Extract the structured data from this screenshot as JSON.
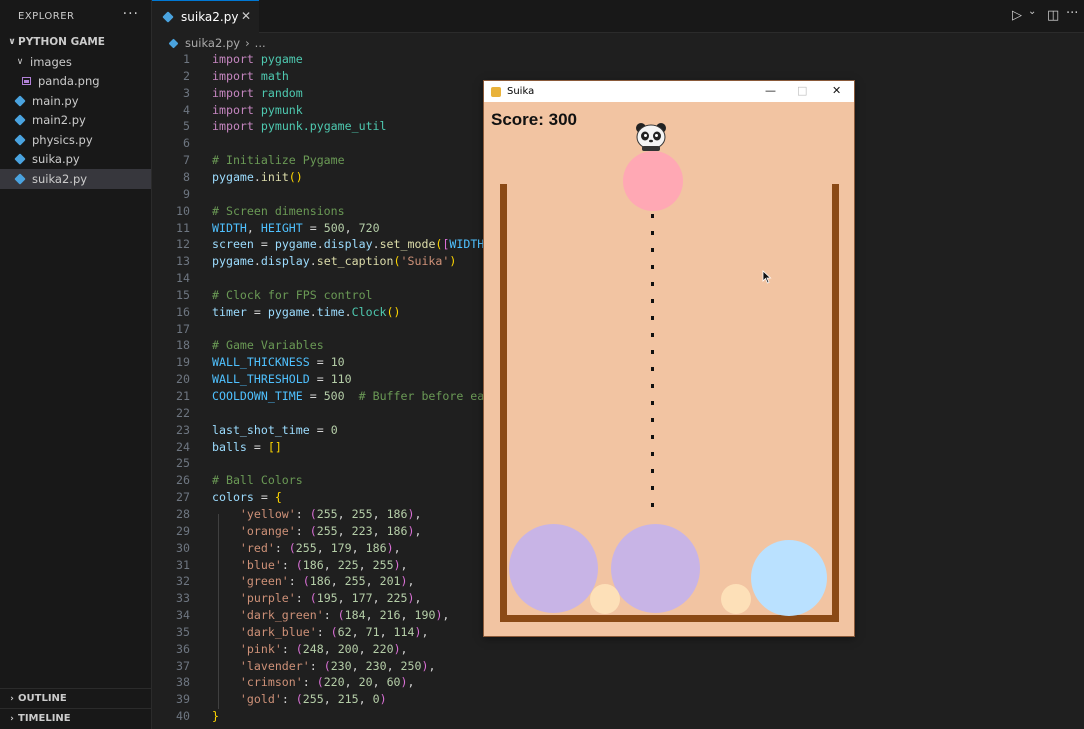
{
  "sidebar": {
    "title": "EXPLORER",
    "more": "···",
    "folder": "PYTHON GAME",
    "subfolder": "images",
    "items": [
      {
        "label": "panda.png"
      },
      {
        "label": "main.py"
      },
      {
        "label": "main2.py"
      },
      {
        "label": "physics.py"
      },
      {
        "label": "suika.py"
      },
      {
        "label": "suika2.py"
      }
    ],
    "outline": "OUTLINE",
    "timeline": "TIMELINE"
  },
  "tab": {
    "label": "suika2.py",
    "close": "✕"
  },
  "breadcrumb": {
    "file": "suika2.py",
    "rest": "..."
  },
  "toolbar": {
    "run": "▷",
    "run_menu": "⌄",
    "split": "◫",
    "more": "···"
  },
  "editor": {
    "line_numbers": [
      "1",
      "2",
      "3",
      "4",
      "5",
      "6",
      "7",
      "8",
      "9",
      "10",
      "11",
      "12",
      "13",
      "14",
      "15",
      "16",
      "17",
      "18",
      "19",
      "20",
      "21",
      "22",
      "23",
      "24",
      "25",
      "26",
      "27",
      "28",
      "29",
      "30",
      "31",
      "32",
      "33",
      "34",
      "35",
      "36",
      "37",
      "38",
      "39",
      "40"
    ],
    "lines": [
      [
        {
          "t": "import ",
          "c": "kw"
        },
        {
          "t": "pygame",
          "c": "mod"
        }
      ],
      [
        {
          "t": "import ",
          "c": "kw"
        },
        {
          "t": "math",
          "c": "mod"
        }
      ],
      [
        {
          "t": "import ",
          "c": "kw"
        },
        {
          "t": "random",
          "c": "mod"
        }
      ],
      [
        {
          "t": "import ",
          "c": "kw"
        },
        {
          "t": "pymunk",
          "c": "mod"
        }
      ],
      [
        {
          "t": "import ",
          "c": "kw"
        },
        {
          "t": "pymunk.pygame_util",
          "c": "mod"
        }
      ],
      [],
      [
        {
          "t": "# Initialize Pygame",
          "c": "cm"
        }
      ],
      [
        {
          "t": "pygame",
          "c": "var"
        },
        {
          "t": ".",
          "c": "op"
        },
        {
          "t": "init",
          "c": "fn"
        },
        {
          "t": "()",
          "c": "br"
        }
      ],
      [],
      [
        {
          "t": "# Screen dimensions",
          "c": "cm"
        }
      ],
      [
        {
          "t": "WIDTH",
          "c": "const"
        },
        {
          "t": ", ",
          "c": "op"
        },
        {
          "t": "HEIGHT",
          "c": "const"
        },
        {
          "t": " = ",
          "c": "op"
        },
        {
          "t": "500",
          "c": "num"
        },
        {
          "t": ", ",
          "c": "op"
        },
        {
          "t": "720",
          "c": "num"
        }
      ],
      [
        {
          "t": "screen",
          "c": "var"
        },
        {
          "t": " = ",
          "c": "op"
        },
        {
          "t": "pygame",
          "c": "var"
        },
        {
          "t": ".",
          "c": "op"
        },
        {
          "t": "display",
          "c": "var"
        },
        {
          "t": ".",
          "c": "op"
        },
        {
          "t": "set_mode",
          "c": "fn"
        },
        {
          "t": "(",
          "c": "br"
        },
        {
          "t": "[",
          "c": "br2"
        },
        {
          "t": "WIDTH",
          "c": "const"
        }
      ],
      [
        {
          "t": "pygame",
          "c": "var"
        },
        {
          "t": ".",
          "c": "op"
        },
        {
          "t": "display",
          "c": "var"
        },
        {
          "t": ".",
          "c": "op"
        },
        {
          "t": "set_caption",
          "c": "fn"
        },
        {
          "t": "(",
          "c": "br"
        },
        {
          "t": "'Suika'",
          "c": "str"
        },
        {
          "t": ")",
          "c": "br"
        }
      ],
      [],
      [
        {
          "t": "# Clock for FPS control",
          "c": "cm"
        }
      ],
      [
        {
          "t": "timer",
          "c": "var"
        },
        {
          "t": " = ",
          "c": "op"
        },
        {
          "t": "pygame",
          "c": "var"
        },
        {
          "t": ".",
          "c": "op"
        },
        {
          "t": "time",
          "c": "var"
        },
        {
          "t": ".",
          "c": "op"
        },
        {
          "t": "Clock",
          "c": "mod"
        },
        {
          "t": "()",
          "c": "br"
        }
      ],
      [],
      [
        {
          "t": "# Game Variables",
          "c": "cm"
        }
      ],
      [
        {
          "t": "WALL_THICKNESS",
          "c": "const"
        },
        {
          "t": " = ",
          "c": "op"
        },
        {
          "t": "10",
          "c": "num"
        }
      ],
      [
        {
          "t": "WALL_THRESHOLD",
          "c": "const"
        },
        {
          "t": " = ",
          "c": "op"
        },
        {
          "t": "110",
          "c": "num"
        }
      ],
      [
        {
          "t": "COOLDOWN_TIME",
          "c": "const"
        },
        {
          "t": " = ",
          "c": "op"
        },
        {
          "t": "500",
          "c": "num"
        },
        {
          "t": "  ",
          "c": "op"
        },
        {
          "t": "# Buffer before ea",
          "c": "cm"
        }
      ],
      [],
      [
        {
          "t": "last_shot_time",
          "c": "var"
        },
        {
          "t": " = ",
          "c": "op"
        },
        {
          "t": "0",
          "c": "num"
        }
      ],
      [
        {
          "t": "balls",
          "c": "var"
        },
        {
          "t": " = ",
          "c": "op"
        },
        {
          "t": "[]",
          "c": "br"
        }
      ],
      [],
      [
        {
          "t": "# Ball Colors",
          "c": "cm"
        }
      ],
      [
        {
          "t": "colors",
          "c": "var"
        },
        {
          "t": " = ",
          "c": "op"
        },
        {
          "t": "{",
          "c": "br"
        }
      ],
      [
        {
          "t": "    ",
          "c": "op"
        },
        {
          "t": "'yellow'",
          "c": "str"
        },
        {
          "t": ": ",
          "c": "op"
        },
        {
          "t": "(",
          "c": "br2"
        },
        {
          "t": "255",
          "c": "num"
        },
        {
          "t": ", ",
          "c": "op"
        },
        {
          "t": "255",
          "c": "num"
        },
        {
          "t": ", ",
          "c": "op"
        },
        {
          "t": "186",
          "c": "num"
        },
        {
          "t": ")",
          "c": "br2"
        },
        {
          "t": ",",
          "c": "op"
        }
      ],
      [
        {
          "t": "    ",
          "c": "op"
        },
        {
          "t": "'orange'",
          "c": "str"
        },
        {
          "t": ": ",
          "c": "op"
        },
        {
          "t": "(",
          "c": "br2"
        },
        {
          "t": "255",
          "c": "num"
        },
        {
          "t": ", ",
          "c": "op"
        },
        {
          "t": "223",
          "c": "num"
        },
        {
          "t": ", ",
          "c": "op"
        },
        {
          "t": "186",
          "c": "num"
        },
        {
          "t": ")",
          "c": "br2"
        },
        {
          "t": ",",
          "c": "op"
        }
      ],
      [
        {
          "t": "    ",
          "c": "op"
        },
        {
          "t": "'red'",
          "c": "str"
        },
        {
          "t": ": ",
          "c": "op"
        },
        {
          "t": "(",
          "c": "br2"
        },
        {
          "t": "255",
          "c": "num"
        },
        {
          "t": ", ",
          "c": "op"
        },
        {
          "t": "179",
          "c": "num"
        },
        {
          "t": ", ",
          "c": "op"
        },
        {
          "t": "186",
          "c": "num"
        },
        {
          "t": ")",
          "c": "br2"
        },
        {
          "t": ",",
          "c": "op"
        }
      ],
      [
        {
          "t": "    ",
          "c": "op"
        },
        {
          "t": "'blue'",
          "c": "str"
        },
        {
          "t": ": ",
          "c": "op"
        },
        {
          "t": "(",
          "c": "br2"
        },
        {
          "t": "186",
          "c": "num"
        },
        {
          "t": ", ",
          "c": "op"
        },
        {
          "t": "225",
          "c": "num"
        },
        {
          "t": ", ",
          "c": "op"
        },
        {
          "t": "255",
          "c": "num"
        },
        {
          "t": ")",
          "c": "br2"
        },
        {
          "t": ",",
          "c": "op"
        }
      ],
      [
        {
          "t": "    ",
          "c": "op"
        },
        {
          "t": "'green'",
          "c": "str"
        },
        {
          "t": ": ",
          "c": "op"
        },
        {
          "t": "(",
          "c": "br2"
        },
        {
          "t": "186",
          "c": "num"
        },
        {
          "t": ", ",
          "c": "op"
        },
        {
          "t": "255",
          "c": "num"
        },
        {
          "t": ", ",
          "c": "op"
        },
        {
          "t": "201",
          "c": "num"
        },
        {
          "t": ")",
          "c": "br2"
        },
        {
          "t": ",",
          "c": "op"
        }
      ],
      [
        {
          "t": "    ",
          "c": "op"
        },
        {
          "t": "'purple'",
          "c": "str"
        },
        {
          "t": ": ",
          "c": "op"
        },
        {
          "t": "(",
          "c": "br2"
        },
        {
          "t": "195",
          "c": "num"
        },
        {
          "t": ", ",
          "c": "op"
        },
        {
          "t": "177",
          "c": "num"
        },
        {
          "t": ", ",
          "c": "op"
        },
        {
          "t": "225",
          "c": "num"
        },
        {
          "t": ")",
          "c": "br2"
        },
        {
          "t": ",",
          "c": "op"
        }
      ],
      [
        {
          "t": "    ",
          "c": "op"
        },
        {
          "t": "'dark_green'",
          "c": "str"
        },
        {
          "t": ": ",
          "c": "op"
        },
        {
          "t": "(",
          "c": "br2"
        },
        {
          "t": "184",
          "c": "num"
        },
        {
          "t": ", ",
          "c": "op"
        },
        {
          "t": "216",
          "c": "num"
        },
        {
          "t": ", ",
          "c": "op"
        },
        {
          "t": "190",
          "c": "num"
        },
        {
          "t": ")",
          "c": "br2"
        },
        {
          "t": ",",
          "c": "op"
        }
      ],
      [
        {
          "t": "    ",
          "c": "op"
        },
        {
          "t": "'dark_blue'",
          "c": "str"
        },
        {
          "t": ": ",
          "c": "op"
        },
        {
          "t": "(",
          "c": "br2"
        },
        {
          "t": "62",
          "c": "num"
        },
        {
          "t": ", ",
          "c": "op"
        },
        {
          "t": "71",
          "c": "num"
        },
        {
          "t": ", ",
          "c": "op"
        },
        {
          "t": "114",
          "c": "num"
        },
        {
          "t": ")",
          "c": "br2"
        },
        {
          "t": ",",
          "c": "op"
        }
      ],
      [
        {
          "t": "    ",
          "c": "op"
        },
        {
          "t": "'pink'",
          "c": "str"
        },
        {
          "t": ": ",
          "c": "op"
        },
        {
          "t": "(",
          "c": "br2"
        },
        {
          "t": "248",
          "c": "num"
        },
        {
          "t": ", ",
          "c": "op"
        },
        {
          "t": "200",
          "c": "num"
        },
        {
          "t": ", ",
          "c": "op"
        },
        {
          "t": "220",
          "c": "num"
        },
        {
          "t": ")",
          "c": "br2"
        },
        {
          "t": ",",
          "c": "op"
        }
      ],
      [
        {
          "t": "    ",
          "c": "op"
        },
        {
          "t": "'lavender'",
          "c": "str"
        },
        {
          "t": ": ",
          "c": "op"
        },
        {
          "t": "(",
          "c": "br2"
        },
        {
          "t": "230",
          "c": "num"
        },
        {
          "t": ", ",
          "c": "op"
        },
        {
          "t": "230",
          "c": "num"
        },
        {
          "t": ", ",
          "c": "op"
        },
        {
          "t": "250",
          "c": "num"
        },
        {
          "t": ")",
          "c": "br2"
        },
        {
          "t": ",",
          "c": "op"
        }
      ],
      [
        {
          "t": "    ",
          "c": "op"
        },
        {
          "t": "'crimson'",
          "c": "str"
        },
        {
          "t": ": ",
          "c": "op"
        },
        {
          "t": "(",
          "c": "br2"
        },
        {
          "t": "220",
          "c": "num"
        },
        {
          "t": ", ",
          "c": "op"
        },
        {
          "t": "20",
          "c": "num"
        },
        {
          "t": ", ",
          "c": "op"
        },
        {
          "t": "60",
          "c": "num"
        },
        {
          "t": ")",
          "c": "br2"
        },
        {
          "t": ",",
          "c": "op"
        }
      ],
      [
        {
          "t": "    ",
          "c": "op"
        },
        {
          "t": "'gold'",
          "c": "str"
        },
        {
          "t": ": ",
          "c": "op"
        },
        {
          "t": "(",
          "c": "br2"
        },
        {
          "t": "255",
          "c": "num"
        },
        {
          "t": ", ",
          "c": "op"
        },
        {
          "t": "215",
          "c": "num"
        },
        {
          "t": ", ",
          "c": "op"
        },
        {
          "t": "0",
          "c": "num"
        },
        {
          "t": ")",
          "c": "br2"
        }
      ],
      [
        {
          "t": "}",
          "c": "br"
        }
      ]
    ]
  },
  "game": {
    "title": "Suika",
    "score_text": "Score: 300",
    "controls": {
      "minimize": "—",
      "maximize": "□",
      "close": "✕"
    },
    "colors": {
      "background": "#f2c4a2",
      "wall": "#8b4a16"
    },
    "balls": [
      {
        "color": "#ffa8b4"
      },
      {
        "color": "#c8b4e6"
      },
      {
        "color": "#c8b4e6"
      },
      {
        "color": "#bae1ff"
      },
      {
        "color": "#fde0b8"
      },
      {
        "color": "#fde0b8"
      }
    ]
  }
}
